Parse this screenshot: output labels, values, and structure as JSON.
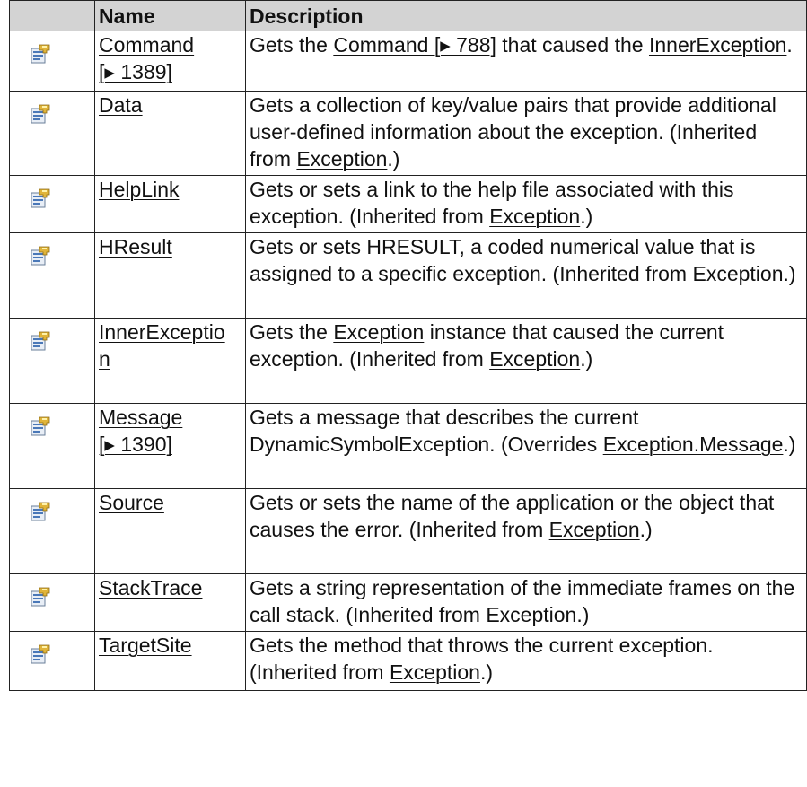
{
  "headers": {
    "icon": "",
    "name": "Name",
    "description": "Description"
  },
  "rows": [
    {
      "name": "Command\n[▸ 1389]",
      "name_parts": [
        "Command",
        "[▸ 1389]"
      ],
      "icon": "property-icon",
      "desc_parts": [
        {
          "t": "Gets the ",
          "l": false
        },
        {
          "t": "Command [▸ 788]",
          "l": true
        },
        {
          "t": " that caused the ",
          "l": false
        },
        {
          "t": "InnerException",
          "l": true
        },
        {
          "t": ".",
          "l": false
        }
      ]
    },
    {
      "name_parts": [
        "Data"
      ],
      "icon": "property-icon",
      "desc_parts": [
        {
          "t": "Gets a collection of key/value pairs that provide additional user-defined information about the exception. (Inherited from ",
          "l": false
        },
        {
          "t": "Exception",
          "l": true
        },
        {
          "t": ".)",
          "l": false
        }
      ]
    },
    {
      "name_parts": [
        "HelpLink"
      ],
      "icon": "property-icon",
      "desc_parts": [
        {
          "t": "Gets or sets a link to the help file associated with this exception. (Inherited from ",
          "l": false
        },
        {
          "t": "Exception",
          "l": true
        },
        {
          "t": ".)",
          "l": false
        }
      ]
    },
    {
      "name_parts": [
        "HResult"
      ],
      "icon": "property-icon",
      "desc_parts": [
        {
          "t": "Gets or sets HRESULT, a coded numerical value that is assigned to a specific exception. (Inherited from ",
          "l": false
        },
        {
          "t": "Exception",
          "l": true
        },
        {
          "t": ".)",
          "l": false
        }
      ]
    },
    {
      "name_parts": [
        "InnerExceptio",
        "n"
      ],
      "icon": "property-icon",
      "desc_parts": [
        {
          "t": "Gets the ",
          "l": false
        },
        {
          "t": "Exception",
          "l": true
        },
        {
          "t": " instance that caused the current exception. (Inherited from ",
          "l": false
        },
        {
          "t": "Exception",
          "l": true
        },
        {
          "t": ".)",
          "l": false
        }
      ]
    },
    {
      "name_parts": [
        "Message",
        "[▸ 1390]"
      ],
      "icon": "property-icon",
      "desc_parts": [
        {
          "t": "Gets a message that describes the current DynamicSymbolException. (Overrides ",
          "l": false
        },
        {
          "t": "Exception.Message",
          "l": true
        },
        {
          "t": ".)",
          "l": false
        }
      ]
    },
    {
      "name_parts": [
        "Source"
      ],
      "icon": "property-icon",
      "desc_parts": [
        {
          "t": "Gets or sets the name of the application or the object that causes the error. (Inherited from ",
          "l": false
        },
        {
          "t": "Exception",
          "l": true
        },
        {
          "t": ".)",
          "l": false
        }
      ]
    },
    {
      "name_parts": [
        "StackTrace"
      ],
      "icon": "property-icon",
      "desc_parts": [
        {
          "t": "Gets a string representation of the immediate frames on the call stack. (Inherited from ",
          "l": false
        },
        {
          "t": "Exception",
          "l": true
        },
        {
          "t": ".)",
          "l": false
        }
      ]
    },
    {
      "name_parts": [
        "TargetSite"
      ],
      "icon": "property-icon",
      "desc_parts": [
        {
          "t": "Gets the method that throws the current exception. (Inherited from ",
          "l": false
        },
        {
          "t": "Exception",
          "l": true
        },
        {
          "t": ".)",
          "l": false
        }
      ]
    }
  ]
}
